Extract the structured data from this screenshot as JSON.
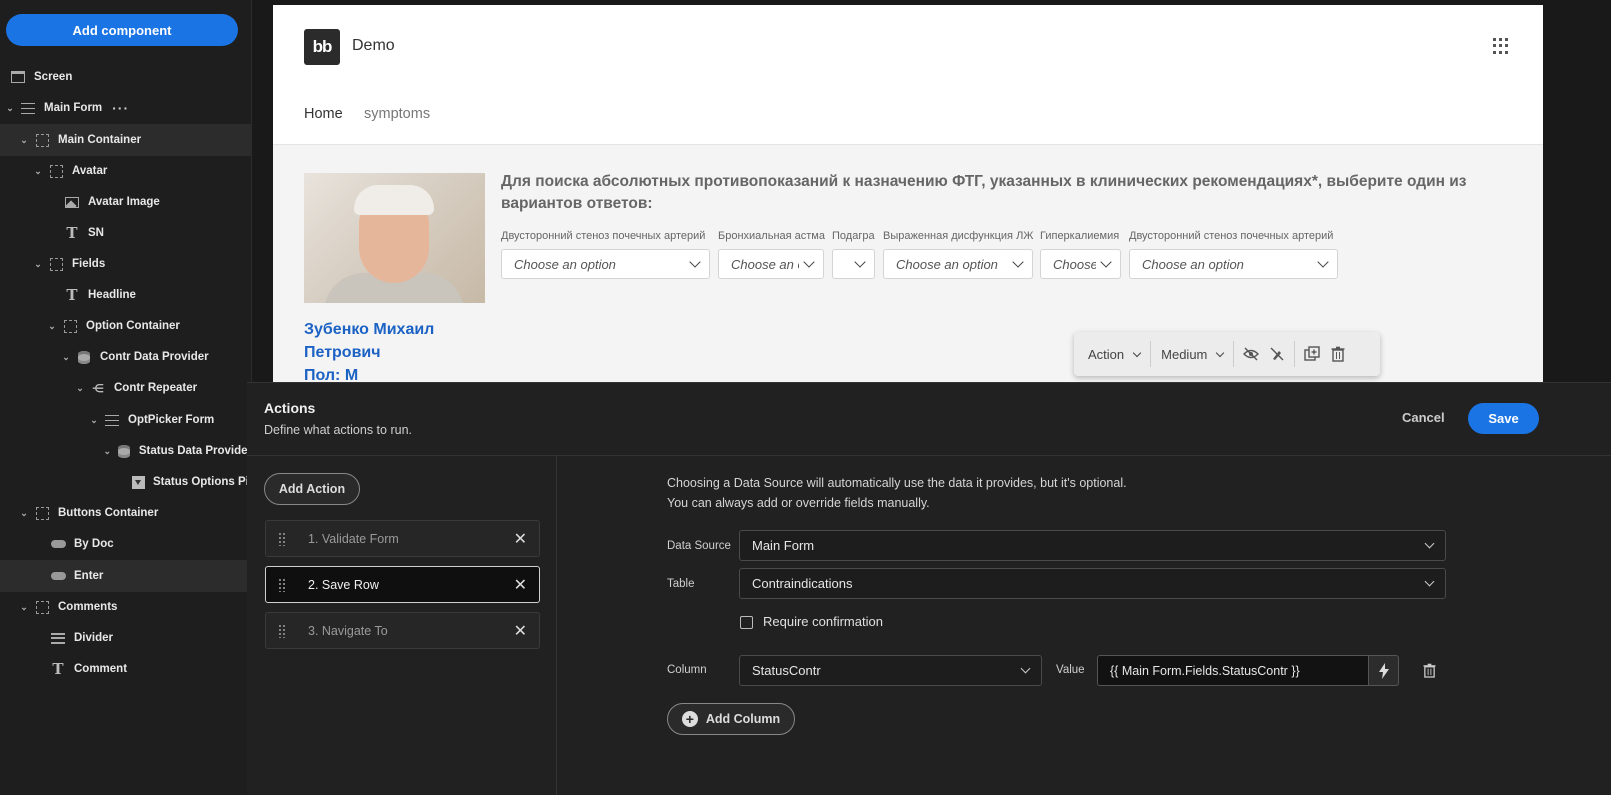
{
  "sidebar": {
    "add_component_label": "Add component",
    "tree": [
      {
        "label": "Screen",
        "icon": "screen-icon"
      },
      {
        "label": "Main Form",
        "icon": "form-icon",
        "more": "···"
      },
      {
        "label": "Main Container",
        "icon": "container-icon"
      },
      {
        "label": "Avatar",
        "icon": "container-icon"
      },
      {
        "label": "Avatar Image",
        "icon": "image-icon"
      },
      {
        "label": "SN",
        "icon": "text-icon"
      },
      {
        "label": "Fields",
        "icon": "container-icon"
      },
      {
        "label": "Headline",
        "icon": "text-icon"
      },
      {
        "label": "Option Container",
        "icon": "container-icon"
      },
      {
        "label": "Contr Data Provider",
        "icon": "database-icon"
      },
      {
        "label": "Contr Repeater",
        "icon": "repeater-icon"
      },
      {
        "label": "OptPicker Form",
        "icon": "form-icon"
      },
      {
        "label": "Status Data Provider",
        "icon": "database-icon"
      },
      {
        "label": "Status Options Picker",
        "icon": "select-icon"
      },
      {
        "label": "Buttons Container",
        "icon": "container-icon"
      },
      {
        "label": "By Doc",
        "icon": "button-icon"
      },
      {
        "label": "Enter",
        "icon": "button-icon"
      },
      {
        "label": "Comments",
        "icon": "container-icon"
      },
      {
        "label": "Divider",
        "icon": "divider-icon"
      },
      {
        "label": "Comment",
        "icon": "text-icon"
      }
    ]
  },
  "preview": {
    "logo_text": "bb",
    "app_title": "Demo",
    "nav": {
      "home": "Home",
      "symptoms": "symptoms"
    },
    "person_name": "Зубенко Михаил Петрович",
    "person_sex": "Пол: М",
    "headline": "Для поиска абсолютных противопоказаний к назначению ФТГ, указанных в клинических рекомендациях*, выберите один из вариантов ответов:",
    "options": [
      {
        "label": "Двусторонний стеноз почечных артерий",
        "value": "Choose an option"
      },
      {
        "label": "Бронхиальная астма",
        "value": "Choose an option"
      },
      {
        "label": "Подагра",
        "value": ""
      },
      {
        "label": "Выраженная дисфункция ЛЖ",
        "value": "Choose an option"
      },
      {
        "label": "Гиперкалиемия",
        "value": "Choose an option"
      },
      {
        "label": "Двусторонний стеноз почечных артерий",
        "value": "Choose an option"
      }
    ],
    "toolbar": {
      "action": "Action",
      "size": "Medium"
    }
  },
  "actions": {
    "title": "Actions",
    "subtitle": "Define what actions to run.",
    "cancel_label": "Cancel",
    "save_label": "Save",
    "add_action_label": "Add Action",
    "list": [
      {
        "label": "1. Validate Form"
      },
      {
        "label": "2. Save Row"
      },
      {
        "label": "3. Navigate To"
      }
    ],
    "help_line1": "Choosing a Data Source will automatically use the data it provides, but it's optional.",
    "help_line2": "You can always add or override fields manually.",
    "data_source_label": "Data Source",
    "data_source_value": "Main Form",
    "table_label": "Table",
    "table_value": "Contraindications",
    "require_confirmation_label": "Require confirmation",
    "column_label": "Column",
    "column_value": "StatusContr",
    "value_label": "Value",
    "value_binding": "{{ Main Form.Fields.StatusContr }}",
    "add_column_label": "Add Column"
  },
  "colors": {
    "accent": "#1b74e4",
    "link": "#1b62c4",
    "panel_bg": "#212121",
    "sidebar_bg": "#1e1e1e"
  }
}
